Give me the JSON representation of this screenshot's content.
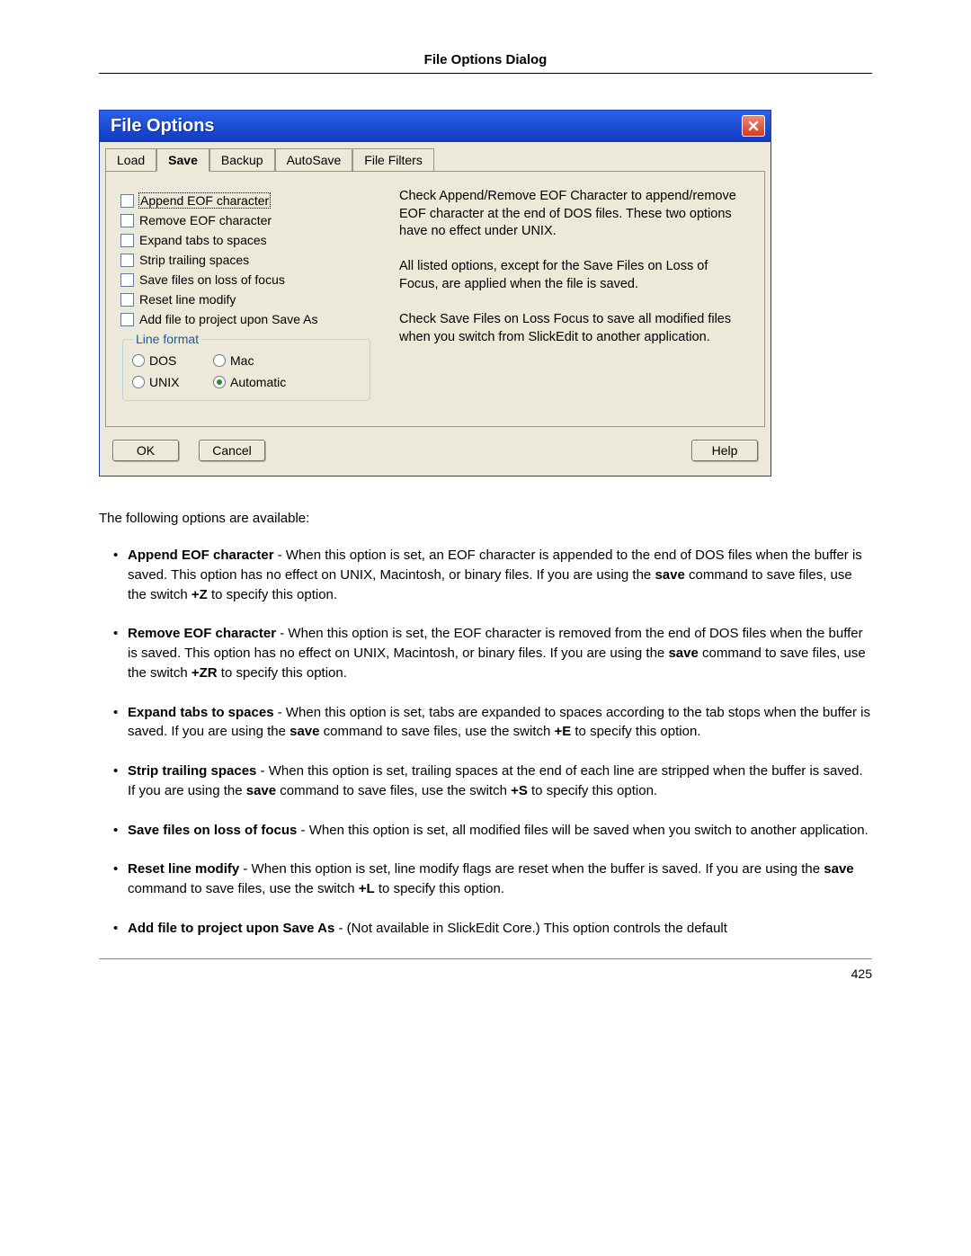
{
  "header": {
    "title": "File Options Dialog"
  },
  "page_number": "425",
  "dialog": {
    "title": "File Options",
    "close_icon": "close-icon",
    "tabs": [
      {
        "label": "Load",
        "active": false
      },
      {
        "label": "Save",
        "active": true
      },
      {
        "label": "Backup",
        "active": false
      },
      {
        "label": "AutoSave",
        "active": false
      },
      {
        "label": "File Filters",
        "active": false
      }
    ],
    "checkboxes": [
      {
        "label": "Append EOF character",
        "checked": false,
        "focused": true
      },
      {
        "label": "Remove EOF character",
        "checked": false
      },
      {
        "label": "Expand tabs to spaces",
        "checked": false
      },
      {
        "label": "Strip trailing spaces",
        "checked": false
      },
      {
        "label": "Save files on loss of focus",
        "checked": false
      },
      {
        "label": "Reset line modify",
        "checked": false
      },
      {
        "label": "Add file to project upon Save As",
        "checked": false
      }
    ],
    "line_format": {
      "legend": "Line format",
      "options": [
        {
          "label": "DOS",
          "selected": false
        },
        {
          "label": "Mac",
          "selected": false
        },
        {
          "label": "UNIX",
          "selected": false
        },
        {
          "label": "Automatic",
          "selected": true
        }
      ]
    },
    "help_text": {
      "p1": "Check Append/Remove EOF Character to append/remove EOF character at the end of DOS files.  These two options have no effect under UNIX.",
      "p2": "All listed options, except for the Save Files on Loss of Focus, are applied when the file is saved.",
      "p3": "Check Save Files on Loss Focus to save all modified files when you switch from SlickEdit to another application."
    },
    "buttons": {
      "ok": "OK",
      "cancel": "Cancel",
      "help": "Help"
    }
  },
  "body": {
    "intro": "The following options are available:",
    "options": [
      {
        "title": "Append EOF character",
        "text_a": " - When this option is set, an EOF character is appended to the end of DOS files when the buffer is saved. This option has no effect on UNIX, Macintosh, or binary files. If you are using the ",
        "bold_b": "save",
        "text_c": " command to save files, use the switch ",
        "bold_d": "+Z",
        "text_e": " to specify this option."
      },
      {
        "title": "Remove EOF character",
        "text_a": " - When this option is set, the EOF character is removed from the end of DOS files when the buffer is saved. This option has no effect on UNIX, Macintosh, or binary files. If you are using the ",
        "bold_b": "save",
        "text_c": " command to save files, use the switch ",
        "bold_d": "+ZR",
        "text_e": " to specify this option."
      },
      {
        "title": "Expand tabs to spaces",
        "text_a": " - When this option is set, tabs are expanded to spaces according to the tab stops when the buffer is saved. If you are using the ",
        "bold_b": "save",
        "text_c": " command to save files, use the switch ",
        "bold_d": "+E",
        "text_e": " to specify this option."
      },
      {
        "title": "Strip trailing spaces",
        "text_a": " - When this option is set, trailing spaces at the end of each line are stripped when the buffer is saved. If you are using the ",
        "bold_b": "save",
        "text_c": " command to save files, use the switch ",
        "bold_d": "+S",
        "text_e": " to specify this option."
      },
      {
        "title": "Save files on loss of focus",
        "text_a": " - When this option is set, all modified files will be saved when you switch to another application.",
        "bold_b": "",
        "text_c": "",
        "bold_d": "",
        "text_e": ""
      },
      {
        "title": "Reset line modify",
        "text_a": " - When this option is set, line modify flags are reset when the buffer is saved. If you are using the ",
        "bold_b": "save",
        "text_c": " command to save files, use the switch ",
        "bold_d": "+L",
        "text_e": " to specify this option."
      },
      {
        "title": "Add file to project upon Save As",
        "text_a": " - (Not available in SlickEdit Core.) This option controls the default",
        "bold_b": "",
        "text_c": "",
        "bold_d": "",
        "text_e": ""
      }
    ]
  }
}
